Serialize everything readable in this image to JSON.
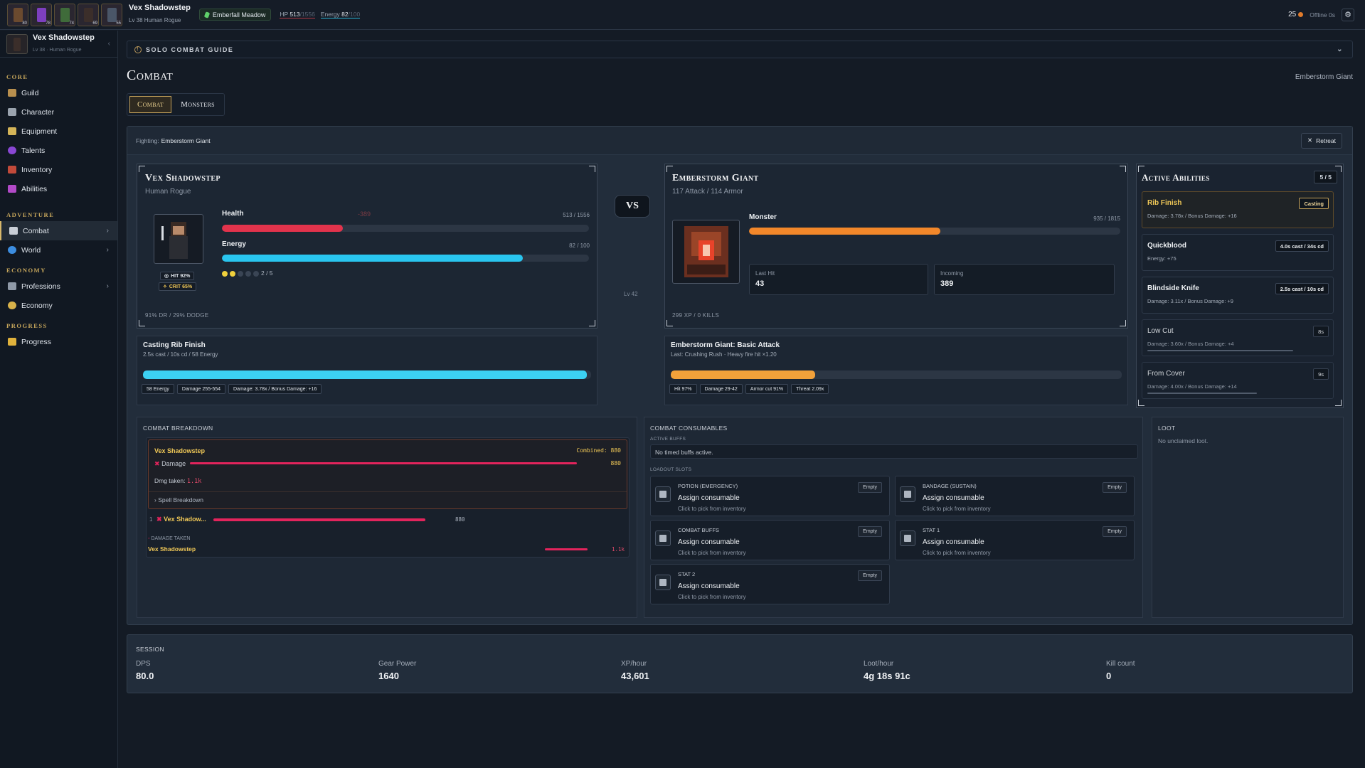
{
  "topbar": {
    "party": [
      {
        "level": "80",
        "color": "#6b4a2f"
      },
      {
        "level": "78",
        "color": "#7d3fbf"
      },
      {
        "level": "74",
        "color": "#3f6b3a"
      },
      {
        "level": "69",
        "color": "#3b2e2a"
      },
      {
        "level": "55",
        "color": "#4a5668"
      }
    ],
    "name": "Vex Shadowstep",
    "subtitle": "Lv 38 Human Rogue",
    "zone": "Emberfall Meadow",
    "hp_label": "HP",
    "hp_value": "513",
    "hp_max": "/1556",
    "energy_label": "Energy",
    "energy_value": "82",
    "energy_max": "/100",
    "coins": "25",
    "offline": "Offline 0s"
  },
  "sidebar": {
    "user_name": "Vex Shadowstep",
    "user_sub": "Lv 38 · Human Rogue",
    "sections": {
      "core": "Core",
      "adventure": "Adventure",
      "economy": "Economy",
      "progress": "Progress"
    },
    "items": {
      "guild": "Guild",
      "character": "Character",
      "equipment": "Equipment",
      "talents": "Talents",
      "inventory": "Inventory",
      "abilities": "Abilities",
      "combat": "Combat",
      "world": "World",
      "professions": "Professions",
      "economy": "Economy",
      "progress": "Progress"
    }
  },
  "guide": {
    "label": "SOLO COMBAT GUIDE"
  },
  "page": {
    "title": "Combat",
    "right_label": "Emberstorm Giant"
  },
  "tabs": [
    "Combat",
    "Monsters"
  ],
  "fight": {
    "prefix": "Fighting:",
    "target": "Emberstorm Giant",
    "retreat": "Retreat"
  },
  "player": {
    "name": "Vex Shadowstep",
    "class": "Human Rogue",
    "health_label": "Health",
    "health_value": "513 / 1556",
    "health_fraction": 0.33,
    "damage_float": "-389",
    "energy_label": "Energy",
    "energy_value": "82 / 100",
    "energy_fraction": 0.82,
    "combo": "2 / 5",
    "combo_filled": 2,
    "combo_total": 5,
    "hit": "HIT 92%",
    "crit": "CRIT 65%",
    "footer": "91% DR / 29% DODGE"
  },
  "vs": {
    "label": "VS",
    "level": "Lv 42"
  },
  "monster": {
    "name": "Emberstorm Giant",
    "stats": "117 Attack / 114 Armor",
    "bar_label": "Monster",
    "health_value": "935 / 1815",
    "health_fraction": 0.515,
    "last_hit_label": "Last Hit",
    "last_hit": "43",
    "incoming_label": "Incoming",
    "incoming": "389",
    "footer": "299 XP / 0 KILLS"
  },
  "player_cast": {
    "title": "Casting Rib Finish",
    "sub": "2.5s cast / 10s cd / 58 Energy",
    "progress": 0.99,
    "chips": [
      "58 Energy",
      "Damage 255-554",
      "Damage: 3.78x / Bonus Damage: +16"
    ]
  },
  "monster_cast": {
    "title": "Emberstorm Giant: Basic Attack",
    "sub": "Last: Crushing Rush · Heavy fire hit ×1.20",
    "progress": 0.32,
    "chips": [
      "Hit 97%",
      "Damage 29-42",
      "Armor cut 91%",
      "Threat 2.09x"
    ]
  },
  "abilities": {
    "title": "Active Abilities",
    "count": "5 / 5",
    "list": [
      {
        "name": "Rib Finish",
        "detail": "Damage: 3.78x / Bonus Damage: +16",
        "tag": "Casting",
        "cd": 0
      },
      {
        "name": "Quickblood",
        "detail": "Energy: +75",
        "tag": "4.0s cast / 34s cd",
        "cd": 0
      },
      {
        "name": "Blindside Knife",
        "detail": "Damage: 3.11x / Bonus Damage: +9",
        "tag": "2.5s cast / 10s cd",
        "cd": 0
      },
      {
        "name": "Low Cut",
        "detail": "Damage: 3.60x / Bonus Damage: +4",
        "tag": "8s",
        "cd": 0.8
      },
      {
        "name": "From Cover",
        "detail": "Damage: 4.00x / Bonus Damage: +14",
        "tag": "9s",
        "cd": 0.6
      }
    ]
  },
  "breakdown": {
    "title": "COMBAT BREAKDOWN",
    "player": "Vex Shadowstep",
    "combined": "Combined: 880",
    "damage_label": "Damage",
    "damage_value": "880",
    "taken_label": "Dmg taken:",
    "taken_value": "1.1k",
    "spell_breakdown": "Spell Breakdown",
    "rank": "1",
    "rank_name": "Vex Shadow...",
    "rank_value": "880",
    "taken_section": "DAMAGE TAKEN",
    "taken_name": "Vex Shadowstep",
    "taken_total": "1.1k"
  },
  "consumables": {
    "title": "COMBAT CONSUMABLES",
    "active_buffs": "ACTIVE BUFFS",
    "no_buffs": "No timed buffs active.",
    "loadout": "LOADOUT SLOTS",
    "slots": [
      {
        "name": "POTION (EMERGENCY)",
        "action": "Assign consumable",
        "hint": "Click to pick from inventory",
        "state": "Empty"
      },
      {
        "name": "BANDAGE (SUSTAIN)",
        "action": "Assign consumable",
        "hint": "Click to pick from inventory",
        "state": "Empty"
      },
      {
        "name": "COMBAT BUFFS",
        "action": "Assign consumable",
        "hint": "Click to pick from inventory",
        "state": "Empty"
      },
      {
        "name": "STAT 1",
        "action": "Assign consumable",
        "hint": "Click to pick from inventory",
        "state": "Empty"
      },
      {
        "name": "STAT 2",
        "action": "Assign consumable",
        "hint": "Click to pick from inventory",
        "state": "Empty"
      }
    ]
  },
  "loot": {
    "title": "LOOT",
    "empty": "No unclaimed loot."
  },
  "session": {
    "title": "SESSION",
    "stats": [
      {
        "label": "DPS",
        "value": "80.0"
      },
      {
        "label": "Gear Power",
        "value": "1640"
      },
      {
        "label": "XP/hour",
        "value": "43,601"
      },
      {
        "label": "Loot/hour",
        "value": "4g 18s 91c"
      },
      {
        "label": "Kill count",
        "value": "0"
      }
    ]
  },
  "colors": {
    "health": "#e2334c",
    "energy": "#29c5ef",
    "monster": "#f2872a",
    "accent": "#d7b76b",
    "breakdown": "#e2245c"
  }
}
